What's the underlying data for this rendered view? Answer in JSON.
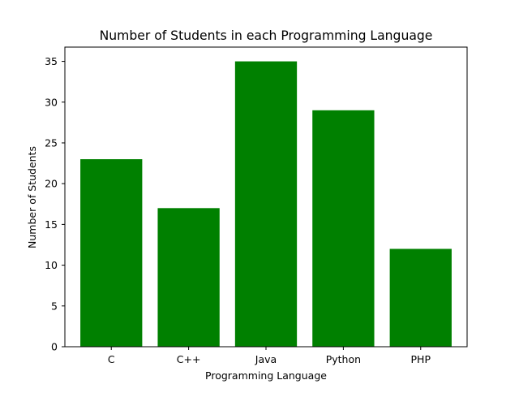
{
  "chart_data": {
    "type": "bar",
    "title": "Number of Students in each Programming Language",
    "xlabel": "Programming Language",
    "ylabel": "Number of Students",
    "categories": [
      "C",
      "C++",
      "Java",
      "Python",
      "PHP"
    ],
    "values": [
      23,
      17,
      35,
      29,
      12
    ],
    "ylim": [
      0,
      36.75
    ],
    "yticks": [
      0,
      5,
      10,
      15,
      20,
      25,
      30,
      35
    ],
    "bar_color": "#008000",
    "grid": false,
    "legend": "none"
  }
}
